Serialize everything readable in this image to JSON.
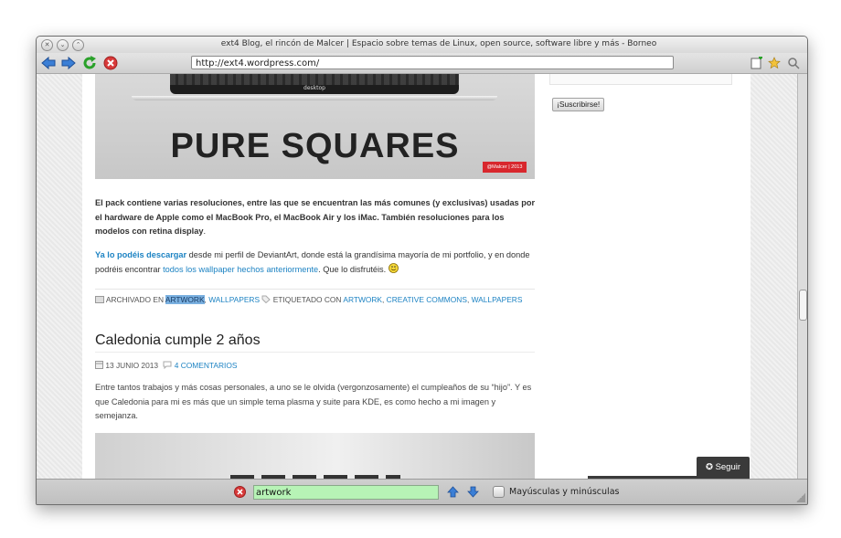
{
  "window": {
    "title": "ext4 Blog, el rincón de Malcer | Espacio sobre temas de Linux, open source, software libre y más - Borneo"
  },
  "toolbar": {
    "url": "http://ext4.wordpress.com/"
  },
  "banner": {
    "screen_label": "desktop",
    "title": "PURE SQUARES",
    "badge": "@Malcer | 2013"
  },
  "post1": {
    "bold_para": "El pack contiene varias resoluciones, entre las que se encuentran las más comunes (y exclusivas) usadas por el hardware de Apple como el MacBook Pro, el MacBook Air y los iMac. También resoluciones para los modelos con retina display",
    "bold_para_end": ".",
    "para2_link": "Ya lo podéis descargar",
    "para2_text1": " desde mi perfil de DeviantArt, donde está la grandísima mayoría de mi portfolio, y en donde podréis encontrar ",
    "para2_link2": "todos los wallpaper hechos anteriormente",
    "para2_text2": ". Que lo disfrutéis.",
    "meta_archived": "ARCHIVADO EN",
    "meta_cat1": "ARTWORK",
    "meta_cat2": "WALLPAPERS",
    "meta_tagged": "ETIQUETADO CON",
    "meta_tag1": "ARTWORK",
    "meta_tag2": "CREATIVE COMMONS",
    "meta_tag3": "WALLPAPERS"
  },
  "post2": {
    "title": "Caledonia cumple 2 años",
    "date": "13 JUNIO 2013",
    "comments": "4 COMENTARIOS",
    "para": "Entre tantos trabajos y más cosas personales, a uno se le olvida (vergonzosamente) el cumpleaños de su “hijo”. Y es que Caledonia para mi es más que un simple tema plasma y suite para KDE, es como hecho a mi imagen y semejanza."
  },
  "sidebar": {
    "subscribe_button": "¡Suscribirse!"
  },
  "follow": {
    "label": "Seguir"
  },
  "findbar": {
    "value": "artwork",
    "match_case_label": "Mayúsculas y minúsculas"
  },
  "colors": {
    "link": "#1d83c3",
    "find_bg": "#b7f3b6",
    "highlight": "#7ab0e0"
  }
}
